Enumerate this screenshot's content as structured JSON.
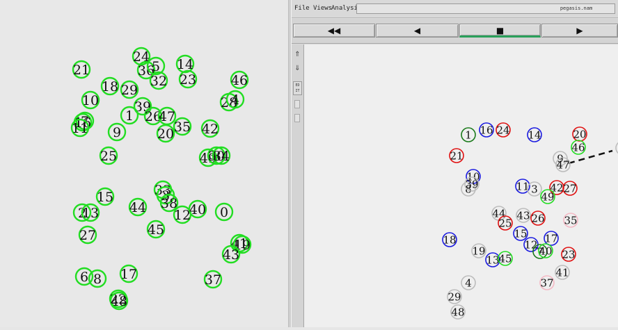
{
  "menu": {
    "file": "File",
    "views": "Views",
    "analysis": "Analysis"
  },
  "window": {
    "filename": "pegasis.nam"
  },
  "transport": {
    "rewind": {
      "label": "◀◀",
      "icon": "rewind-icon"
    },
    "back": {
      "label": "◀",
      "icon": "play-backward-icon"
    },
    "stop": {
      "label": "■",
      "icon": "stop-icon"
    },
    "forward": {
      "label": "▶",
      "icon": "play-forward-icon"
    }
  },
  "edit_tool": {
    "line1": "ED",
    "line2": "IT"
  },
  "colors": {
    "green": "#22dd22",
    "dark_green": "#1a7a1a",
    "red": "#e01010",
    "blue": "#1a1ae0",
    "pink": "#f4b8c4",
    "gray": "#bcbcbc",
    "text": "#111111",
    "link": "#111111"
  },
  "left_nodes": [
    {
      "id": "21"
    },
    {
      "id": "24"
    },
    {
      "id": "36"
    },
    {
      "id": "5"
    },
    {
      "id": "32"
    },
    {
      "id": "14"
    },
    {
      "id": "23"
    },
    {
      "id": "46"
    },
    {
      "id": "18"
    },
    {
      "id": "29"
    },
    {
      "id": "10"
    },
    {
      "id": "28"
    },
    {
      "id": "4"
    },
    {
      "id": "39"
    },
    {
      "id": "26"
    },
    {
      "id": "47"
    },
    {
      "id": "1"
    },
    {
      "id": "7"
    },
    {
      "id": "16"
    },
    {
      "id": "11"
    },
    {
      "id": "9"
    },
    {
      "id": "20"
    },
    {
      "id": "35"
    },
    {
      "id": "42"
    },
    {
      "id": "25"
    },
    {
      "id": "49"
    },
    {
      "id": "30"
    },
    {
      "id": "34"
    },
    {
      "id": "33"
    },
    {
      "id": "3"
    },
    {
      "id": "15"
    },
    {
      "id": "44"
    },
    {
      "id": "38"
    },
    {
      "id": "2"
    },
    {
      "id": "13"
    },
    {
      "id": "12"
    },
    {
      "id": "40"
    },
    {
      "id": "0"
    },
    {
      "id": "27"
    },
    {
      "id": "45"
    },
    {
      "id": "41"
    },
    {
      "id": "19"
    },
    {
      "id": "43"
    },
    {
      "id": "6"
    },
    {
      "id": "8"
    },
    {
      "id": "17"
    },
    {
      "id": "37"
    },
    {
      "id": "22"
    },
    {
      "id": "48"
    }
  ],
  "right_nodes": [
    {
      "id": "1",
      "color": "dark_green"
    },
    {
      "id": "16",
      "color": "blue"
    },
    {
      "id": "24",
      "color": "red"
    },
    {
      "id": "14",
      "color": "blue"
    },
    {
      "id": "20",
      "color": "red"
    },
    {
      "id": "46",
      "color": "green"
    },
    {
      "id": "2",
      "color": "gray"
    },
    {
      "id": "21",
      "color": "red"
    },
    {
      "id": "9",
      "color": "gray"
    },
    {
      "id": "47",
      "color": "gray"
    },
    {
      "id": "10",
      "color": "blue"
    },
    {
      "id": "8",
      "color": "gray"
    },
    {
      "id": "39",
      "color": "gray"
    },
    {
      "id": "11",
      "color": "blue"
    },
    {
      "id": "3",
      "color": "gray"
    },
    {
      "id": "42",
      "color": "red"
    },
    {
      "id": "27",
      "color": "red"
    },
    {
      "id": "49",
      "color": "green"
    },
    {
      "id": "44",
      "color": "gray"
    },
    {
      "id": "43",
      "color": "gray"
    },
    {
      "id": "26",
      "color": "red"
    },
    {
      "id": "25",
      "color": "red"
    },
    {
      "id": "35",
      "color": "pink"
    },
    {
      "id": "15",
      "color": "blue"
    },
    {
      "id": "18",
      "color": "blue"
    },
    {
      "id": "19",
      "color": "gray"
    },
    {
      "id": "13",
      "color": "blue"
    },
    {
      "id": "45",
      "color": "green"
    },
    {
      "id": "12",
      "color": "blue"
    },
    {
      "id": "17",
      "color": "blue"
    },
    {
      "id": "7",
      "color": "dark_green"
    },
    {
      "id": "40",
      "color": "green"
    },
    {
      "id": "23",
      "color": "red"
    },
    {
      "id": "41",
      "color": "gray"
    },
    {
      "id": "4",
      "color": "gray"
    },
    {
      "id": "37",
      "color": "pink"
    },
    {
      "id": "29",
      "color": "gray"
    },
    {
      "id": "48",
      "color": "gray"
    }
  ]
}
